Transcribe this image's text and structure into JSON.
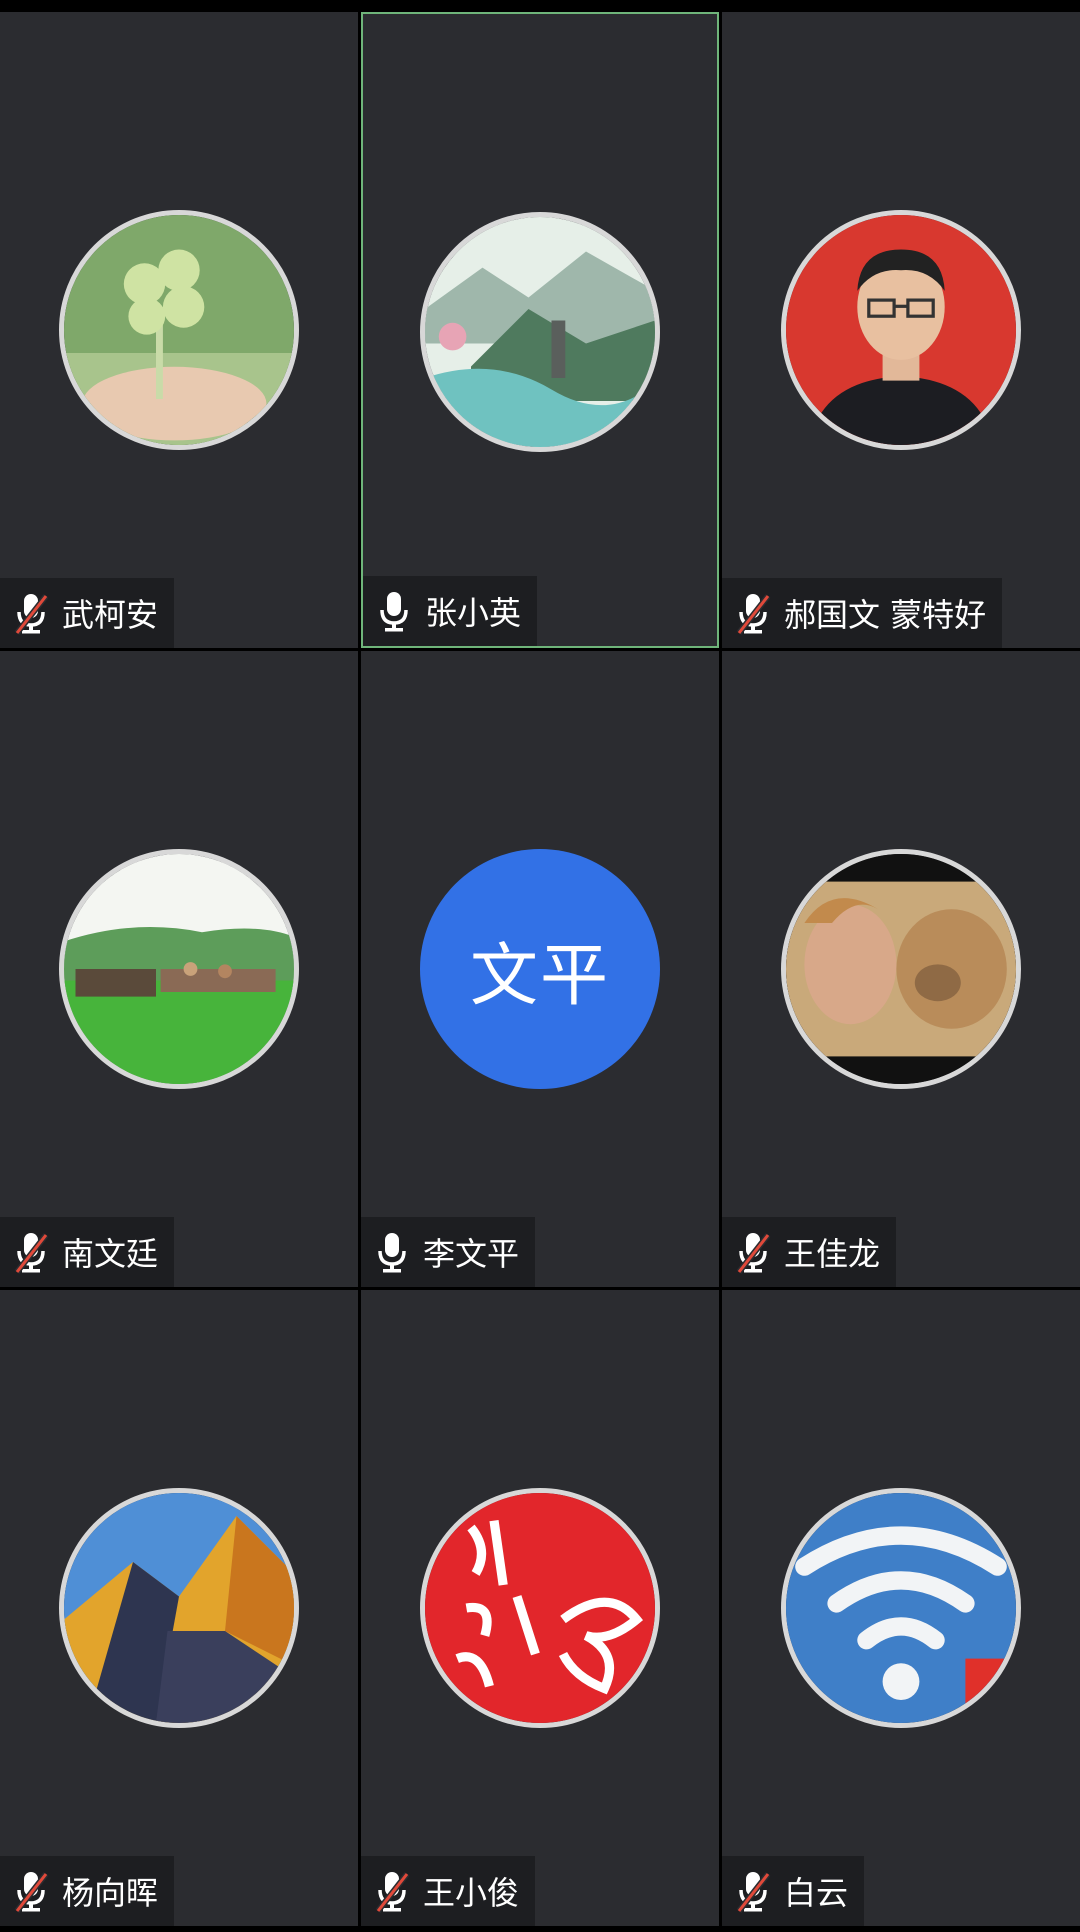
{
  "participants": [
    {
      "name": "武柯安",
      "muted": true,
      "avatar": "clover-photo"
    },
    {
      "name": "张小英",
      "muted": false,
      "active": true,
      "avatar": "landscape-painting"
    },
    {
      "name": "郝国文  蒙特好",
      "muted": true,
      "avatar": "portrait-photo"
    },
    {
      "name": "南文廷",
      "muted": true,
      "avatar": "grassland-photo"
    },
    {
      "name": "李文平",
      "muted": false,
      "avatar_text": "文平",
      "avatar_color": "#3271e6"
    },
    {
      "name": "王佳龙",
      "muted": true,
      "avatar": "lion-photo"
    },
    {
      "name": "杨向晖",
      "muted": true,
      "avatar": "mountain-photo"
    },
    {
      "name": "王小俊",
      "muted": true,
      "avatar": "calligraphy-image"
    },
    {
      "name": "白云",
      "muted": true,
      "avatar": "wifi-cloud-photo"
    }
  ],
  "colors": {
    "tile_bg": "#2b2c30",
    "nameplate_bg": "#1d1e21",
    "active_border": "#6fb57a",
    "muted_slash": "#e0493a"
  }
}
